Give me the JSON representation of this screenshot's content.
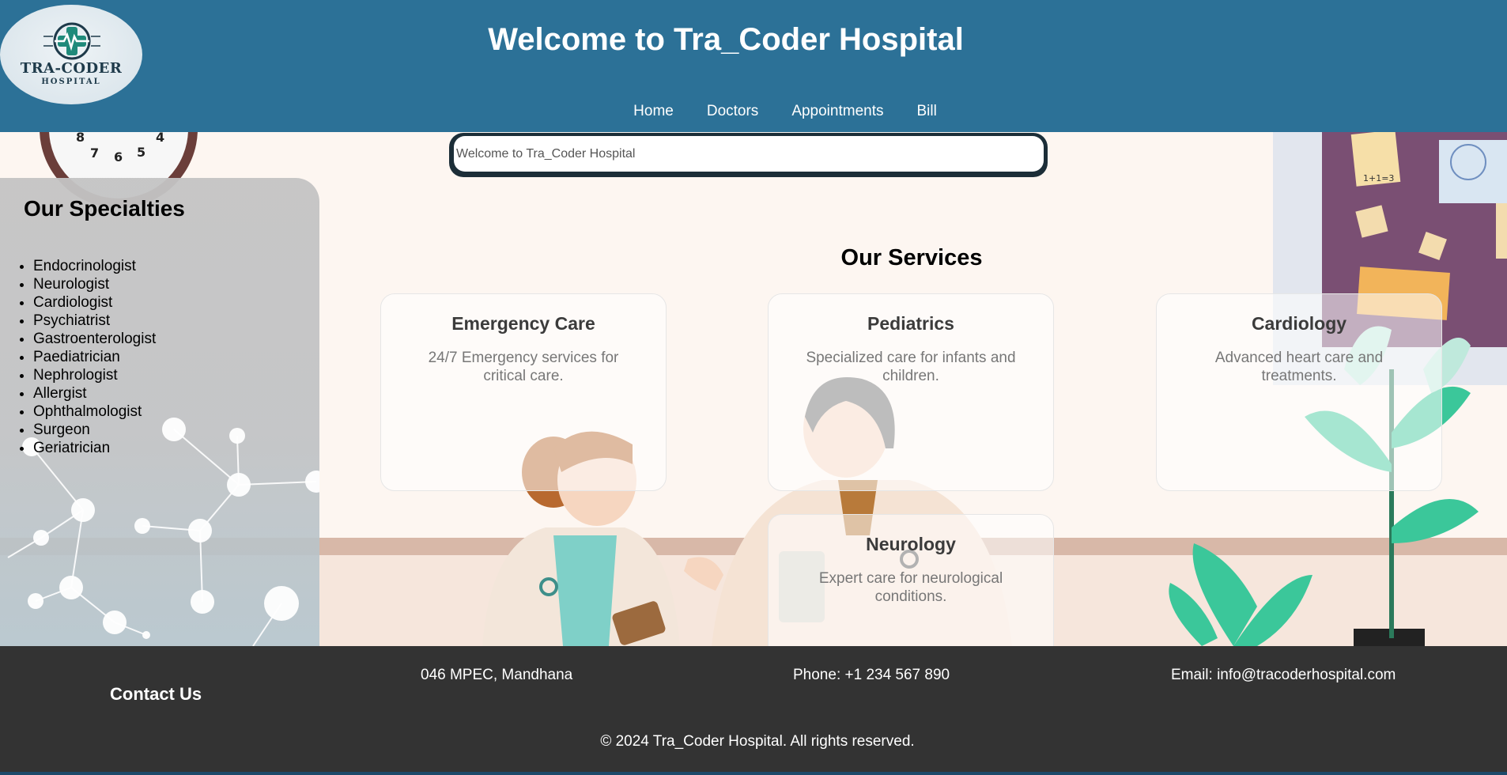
{
  "header": {
    "logo_text": "TRA-CODER",
    "logo_subtext": "HOSPITAL",
    "title": "Welcome to Tra_Coder Hospital",
    "nav": [
      "Home",
      "Doctors",
      "Appointments",
      "Bill"
    ]
  },
  "search": {
    "placeholder": "Welcome to Tra_Coder Hospital"
  },
  "specialties": {
    "title": "Our Specialties",
    "items": [
      "Endocrinologist",
      "Neurologist",
      "Cardiologist",
      "Psychiatrist",
      "Gastroenterologist",
      "Paediatrician",
      "Nephrologist",
      "Allergist",
      "Ophthalmologist",
      "Surgeon",
      "Geriatrician"
    ]
  },
  "services": {
    "title": "Our Services",
    "cards": [
      {
        "title": "Emergency Care",
        "desc": "24/7 Emergency services for critical care."
      },
      {
        "title": "Pediatrics",
        "desc": "Specialized care for infants and children."
      },
      {
        "title": "Cardiology",
        "desc": "Advanced heart care and treatments."
      },
      {
        "title": "Neurology",
        "desc": "Expert care for neurological conditions."
      }
    ]
  },
  "footer": {
    "contact_title": "Contact Us",
    "address": "046 MPEC, Mandhana",
    "phone": "Phone: +1 234 567 890",
    "email": "Email: info@tracoderhospital.com",
    "copyright": "© 2024 Tra_Coder Hospital. All rights reserved."
  },
  "illustration": {
    "clock_numbers": [
      "8",
      "7",
      "6",
      "5",
      "4"
    ],
    "note_text": "1+1=3"
  },
  "colors": {
    "header_bg": "#2c7197",
    "footer_bg": "#333333",
    "hero_bg": "#fdf6f1",
    "search_border": "#1c2e38"
  }
}
